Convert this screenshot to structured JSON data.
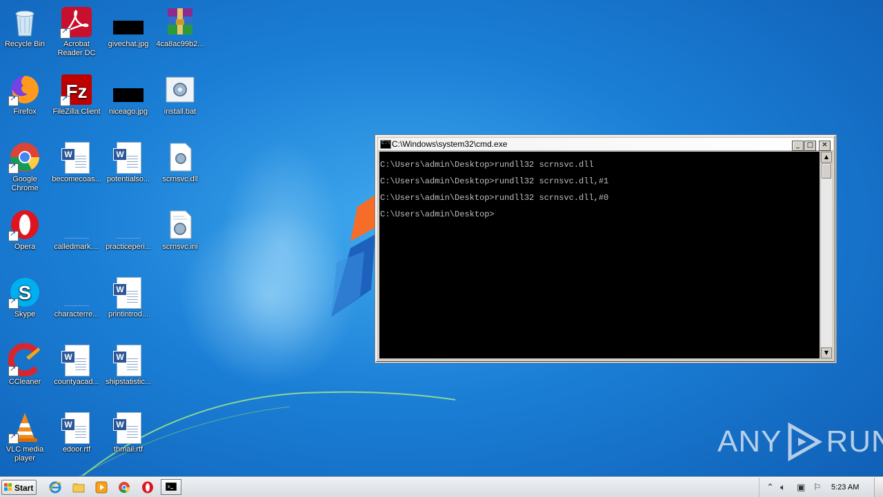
{
  "desktop": {
    "icons": [
      {
        "label": "Recycle Bin"
      },
      {
        "label": "Acrobat Reader DC"
      },
      {
        "label": "givechat.jpg"
      },
      {
        "label": "4ca8ac99b2..."
      },
      {
        "label": "Firefox"
      },
      {
        "label": "FileZilla Client"
      },
      {
        "label": "niceago.jpg"
      },
      {
        "label": "install.bat"
      },
      {
        "label": "Google Chrome"
      },
      {
        "label": "becomecoas..."
      },
      {
        "label": "potentialso..."
      },
      {
        "label": "scrnsvc.dll"
      },
      {
        "label": "Opera"
      },
      {
        "label": "calledmark...."
      },
      {
        "label": "practiceperi..."
      },
      {
        "label": "scrnsvc.ini"
      },
      {
        "label": "Skype"
      },
      {
        "label": "characterre..."
      },
      {
        "label": "printintrod..."
      },
      {
        "label": "CCleaner"
      },
      {
        "label": "countyacad..."
      },
      {
        "label": "shipstatistic..."
      },
      {
        "label": "VLC media player"
      },
      {
        "label": "edoor.rtf"
      },
      {
        "label": "thmail.rtf"
      }
    ]
  },
  "cmd_window": {
    "title": "C:\\Windows\\system32\\cmd.exe",
    "lines": [
      "C:\\Users\\admin\\Desktop>rundll32 scrnsvc.dll",
      "C:\\Users\\admin\\Desktop>rundll32 scrnsvc.dll,#1",
      "C:\\Users\\admin\\Desktop>rundll32 scrnsvc.dll,#0",
      "C:\\Users\\admin\\Desktop>"
    ],
    "buttons": {
      "minimize": "_",
      "maximize": "□",
      "close": "✕"
    }
  },
  "watermark": {
    "left": "ANY",
    "right": "RUN"
  },
  "taskbar": {
    "start_label": "Start",
    "clock": "5:23 AM",
    "tray_icons": [
      "chevron-up-icon",
      "speaker-icon",
      "network-icon",
      "flag-icon"
    ]
  }
}
